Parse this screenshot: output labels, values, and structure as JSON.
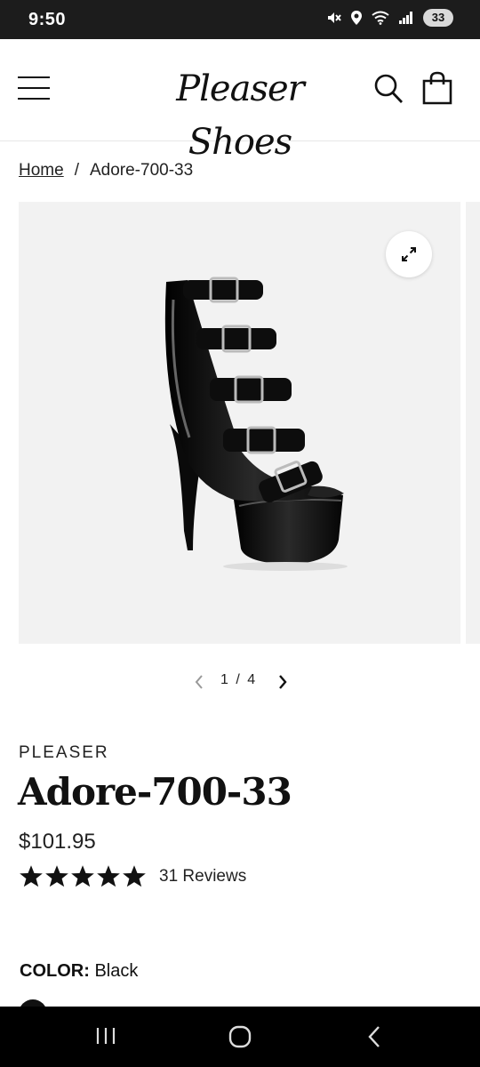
{
  "status_bar": {
    "time": "9:50",
    "battery": "33"
  },
  "header": {
    "logo_text": "Pleaser Shoes"
  },
  "breadcrumb": {
    "home": "Home",
    "separator": "/",
    "current": "Adore-700-33"
  },
  "gallery": {
    "current": "1",
    "separator": "/",
    "total": "4"
  },
  "product": {
    "vendor": "PLEASER",
    "title": "Adore-700-33",
    "price": "$101.95",
    "rating": 5,
    "reviews": "31 Reviews",
    "color_label": "COLOR:",
    "color_value": "Black"
  },
  "colors": {
    "star": "#111111",
    "status_bg": "#1c1c1c",
    "gallery_bg": "#f2f2f2"
  }
}
